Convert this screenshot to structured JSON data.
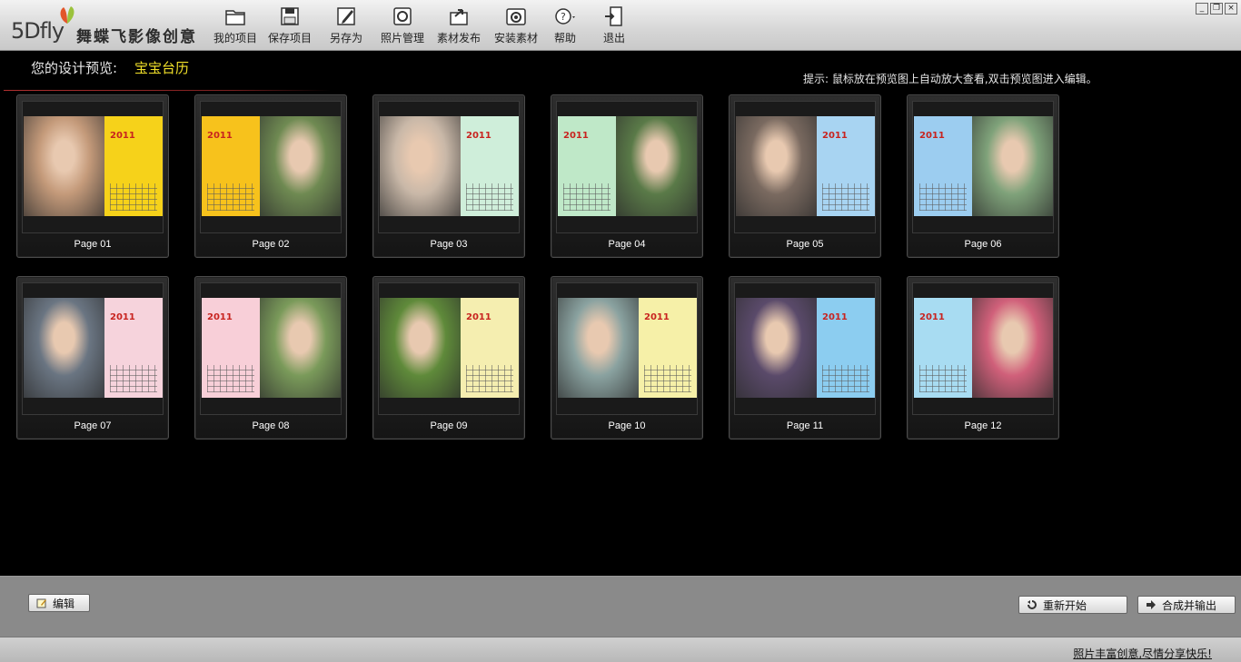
{
  "app": {
    "logo_main": "5Dfly",
    "logo_sub": "舞蝶飞影像创意"
  },
  "toolbar": [
    {
      "label": "我的项目",
      "icon": "folder-icon"
    },
    {
      "label": "保存项目",
      "icon": "save-icon"
    },
    {
      "label": "另存为",
      "icon": "save-as-icon"
    },
    {
      "label": "照片管理",
      "icon": "photo-manage-icon"
    },
    {
      "label": "素材发布",
      "icon": "publish-icon"
    },
    {
      "label": "安装素材",
      "icon": "install-icon"
    },
    {
      "label": "帮助",
      "icon": "help-icon"
    },
    {
      "label": "退出",
      "icon": "exit-icon"
    }
  ],
  "window_controls": [
    "minimize",
    "restore",
    "close"
  ],
  "preview": {
    "title": "您的设计预览:",
    "name": "宝宝台历",
    "hint": "提示: 鼠标放在预览图上自动放大查看,双击预览图进入编辑。"
  },
  "pages": [
    {
      "label": "Page 01",
      "calendar_year": "2011",
      "colors": {
        "panel": "#f6d21a",
        "photo": "#c49a7a"
      }
    },
    {
      "label": "Page 02",
      "calendar_year": "2011",
      "colors": {
        "panel": "#f7c21c",
        "photo": "#6f8a52"
      }
    },
    {
      "label": "Page 03",
      "calendar_year": "2011",
      "colors": {
        "panel": "#cfeeda",
        "photo": "#c9b8a8"
      }
    },
    {
      "label": "Page 04",
      "calendar_year": "2011",
      "colors": {
        "panel": "#bfe8c8",
        "photo": "#5a7a48"
      }
    },
    {
      "label": "Page 05",
      "calendar_year": "2011",
      "colors": {
        "panel": "#a8d4f2",
        "photo": "#7a6a60"
      }
    },
    {
      "label": "Page 06",
      "calendar_year": "2011",
      "colors": {
        "panel": "#9ccdf0",
        "photo": "#7fa27a"
      }
    },
    {
      "label": "Page 07",
      "calendar_year": "2011",
      "colors": {
        "panel": "#f6d3dc",
        "photo": "#6a7582"
      }
    },
    {
      "label": "Page 08",
      "calendar_year": "2011",
      "colors": {
        "panel": "#f8cfd8",
        "photo": "#7a9a5a"
      }
    },
    {
      "label": "Page 09",
      "calendar_year": "2011",
      "colors": {
        "panel": "#f5eeb0",
        "photo": "#5f8a3a"
      }
    },
    {
      "label": "Page 10",
      "calendar_year": "2011",
      "colors": {
        "panel": "#f6f0a8",
        "photo": "#8aa2a0"
      }
    },
    {
      "label": "Page 11",
      "calendar_year": "2011",
      "colors": {
        "panel": "#8ccdf0",
        "photo": "#5a4a6a"
      }
    },
    {
      "label": "Page 12",
      "calendar_year": "2011",
      "colors": {
        "panel": "#a8dcf2",
        "photo": "#d0607a"
      }
    }
  ],
  "bottom": {
    "edit_label": "编辑",
    "restart_label": "重新开始",
    "export_label": "合成并输出"
  },
  "status": {
    "slogan": "照片丰富创意,尽情分享快乐!"
  }
}
